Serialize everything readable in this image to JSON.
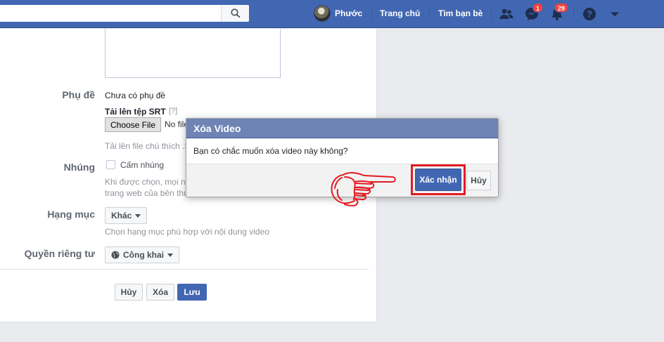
{
  "header": {
    "user_name": "Phước",
    "home_label": "Trang chủ",
    "find_friends_label": "Tìm bạn bè",
    "messages_badge": "1",
    "notifications_badge": "29"
  },
  "form": {
    "subtitle_label": "Phụ đề",
    "subtitle_value": "Chưa có phụ đề",
    "upload_srt_label": "Tải lên tệp SRT",
    "upload_srt_help": "[?]",
    "choose_file_label": "Choose File",
    "no_file_text": "No file",
    "upload_hint": "Tải lên file chú thích .S",
    "embed_label": "Nhúng",
    "embed_checkbox_label": "Cấm nhúng",
    "embed_hint_1": "Khi được chọn, mọi ng",
    "embed_hint_2": "trang web của bên thứ",
    "category_label": "Hạng mục",
    "category_value": "Khác",
    "category_hint": "Chọn hạng mục phù hợp với nội dung video",
    "privacy_label": "Quyền riêng tư",
    "privacy_value": "Công khai",
    "cancel_label": "Hủy",
    "delete_label": "Xóa",
    "save_label": "Lưu"
  },
  "dialog": {
    "title": "Xóa Video",
    "message": "Bạn có chắc muốn xóa video này không?",
    "confirm_label": "Xác nhận",
    "cancel_label": "Hủy"
  },
  "colors": {
    "brand": "#4267b2",
    "highlight": "#e31b23"
  }
}
